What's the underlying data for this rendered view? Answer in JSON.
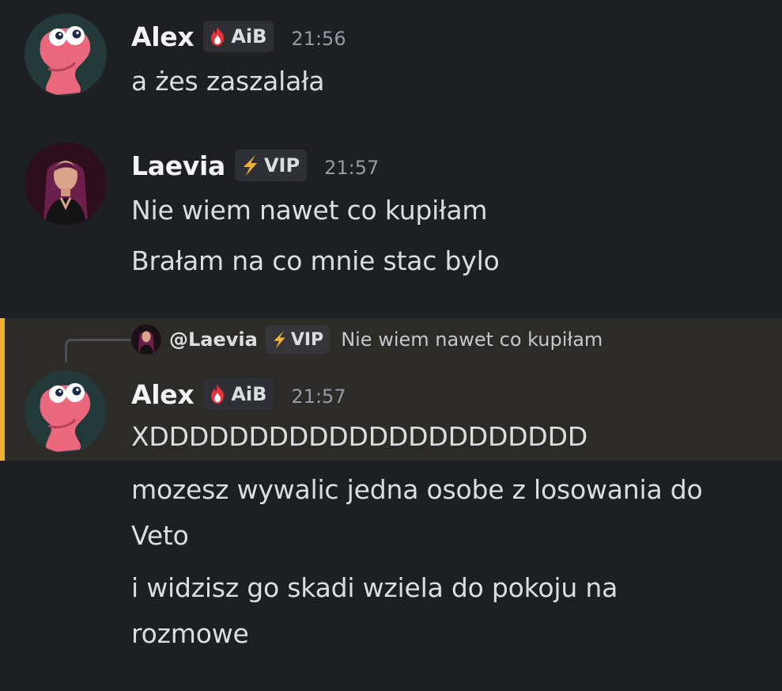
{
  "messages": [
    {
      "author": "Alex",
      "tag": "AiB",
      "tag_icon": "fire-shield-icon",
      "time": "21:56",
      "lines": [
        "a żes zaszalała"
      ]
    },
    {
      "author": "Laevia",
      "tag": "VIP",
      "tag_icon": "lightning-icon",
      "time": "21:57",
      "lines": [
        "Nie wiem nawet co kupiłam",
        "Brałam na co mnie stac bylo"
      ]
    },
    {
      "author": "Alex",
      "tag": "AiB",
      "tag_icon": "fire-shield-icon",
      "time": "21:57",
      "reply": {
        "mention": "@Laevia",
        "tag": "VIP",
        "text": "Nie wiem nawet co kupiłam"
      },
      "lines": [
        "XDDDDDDDDDDDDDDDDDDDDDD",
        "mozesz wywalic jedna osobe z losowania do",
        "Veto",
        "i widzisz go skadi wziela do pokoju na",
        "rozmowe"
      ]
    }
  ],
  "colors": {
    "background": "#1e1f22",
    "highlight": "#2c2b27",
    "highlight_bar": "#f0b232",
    "timestamp": "#949ba4",
    "tag_bg": "#2f3035"
  }
}
